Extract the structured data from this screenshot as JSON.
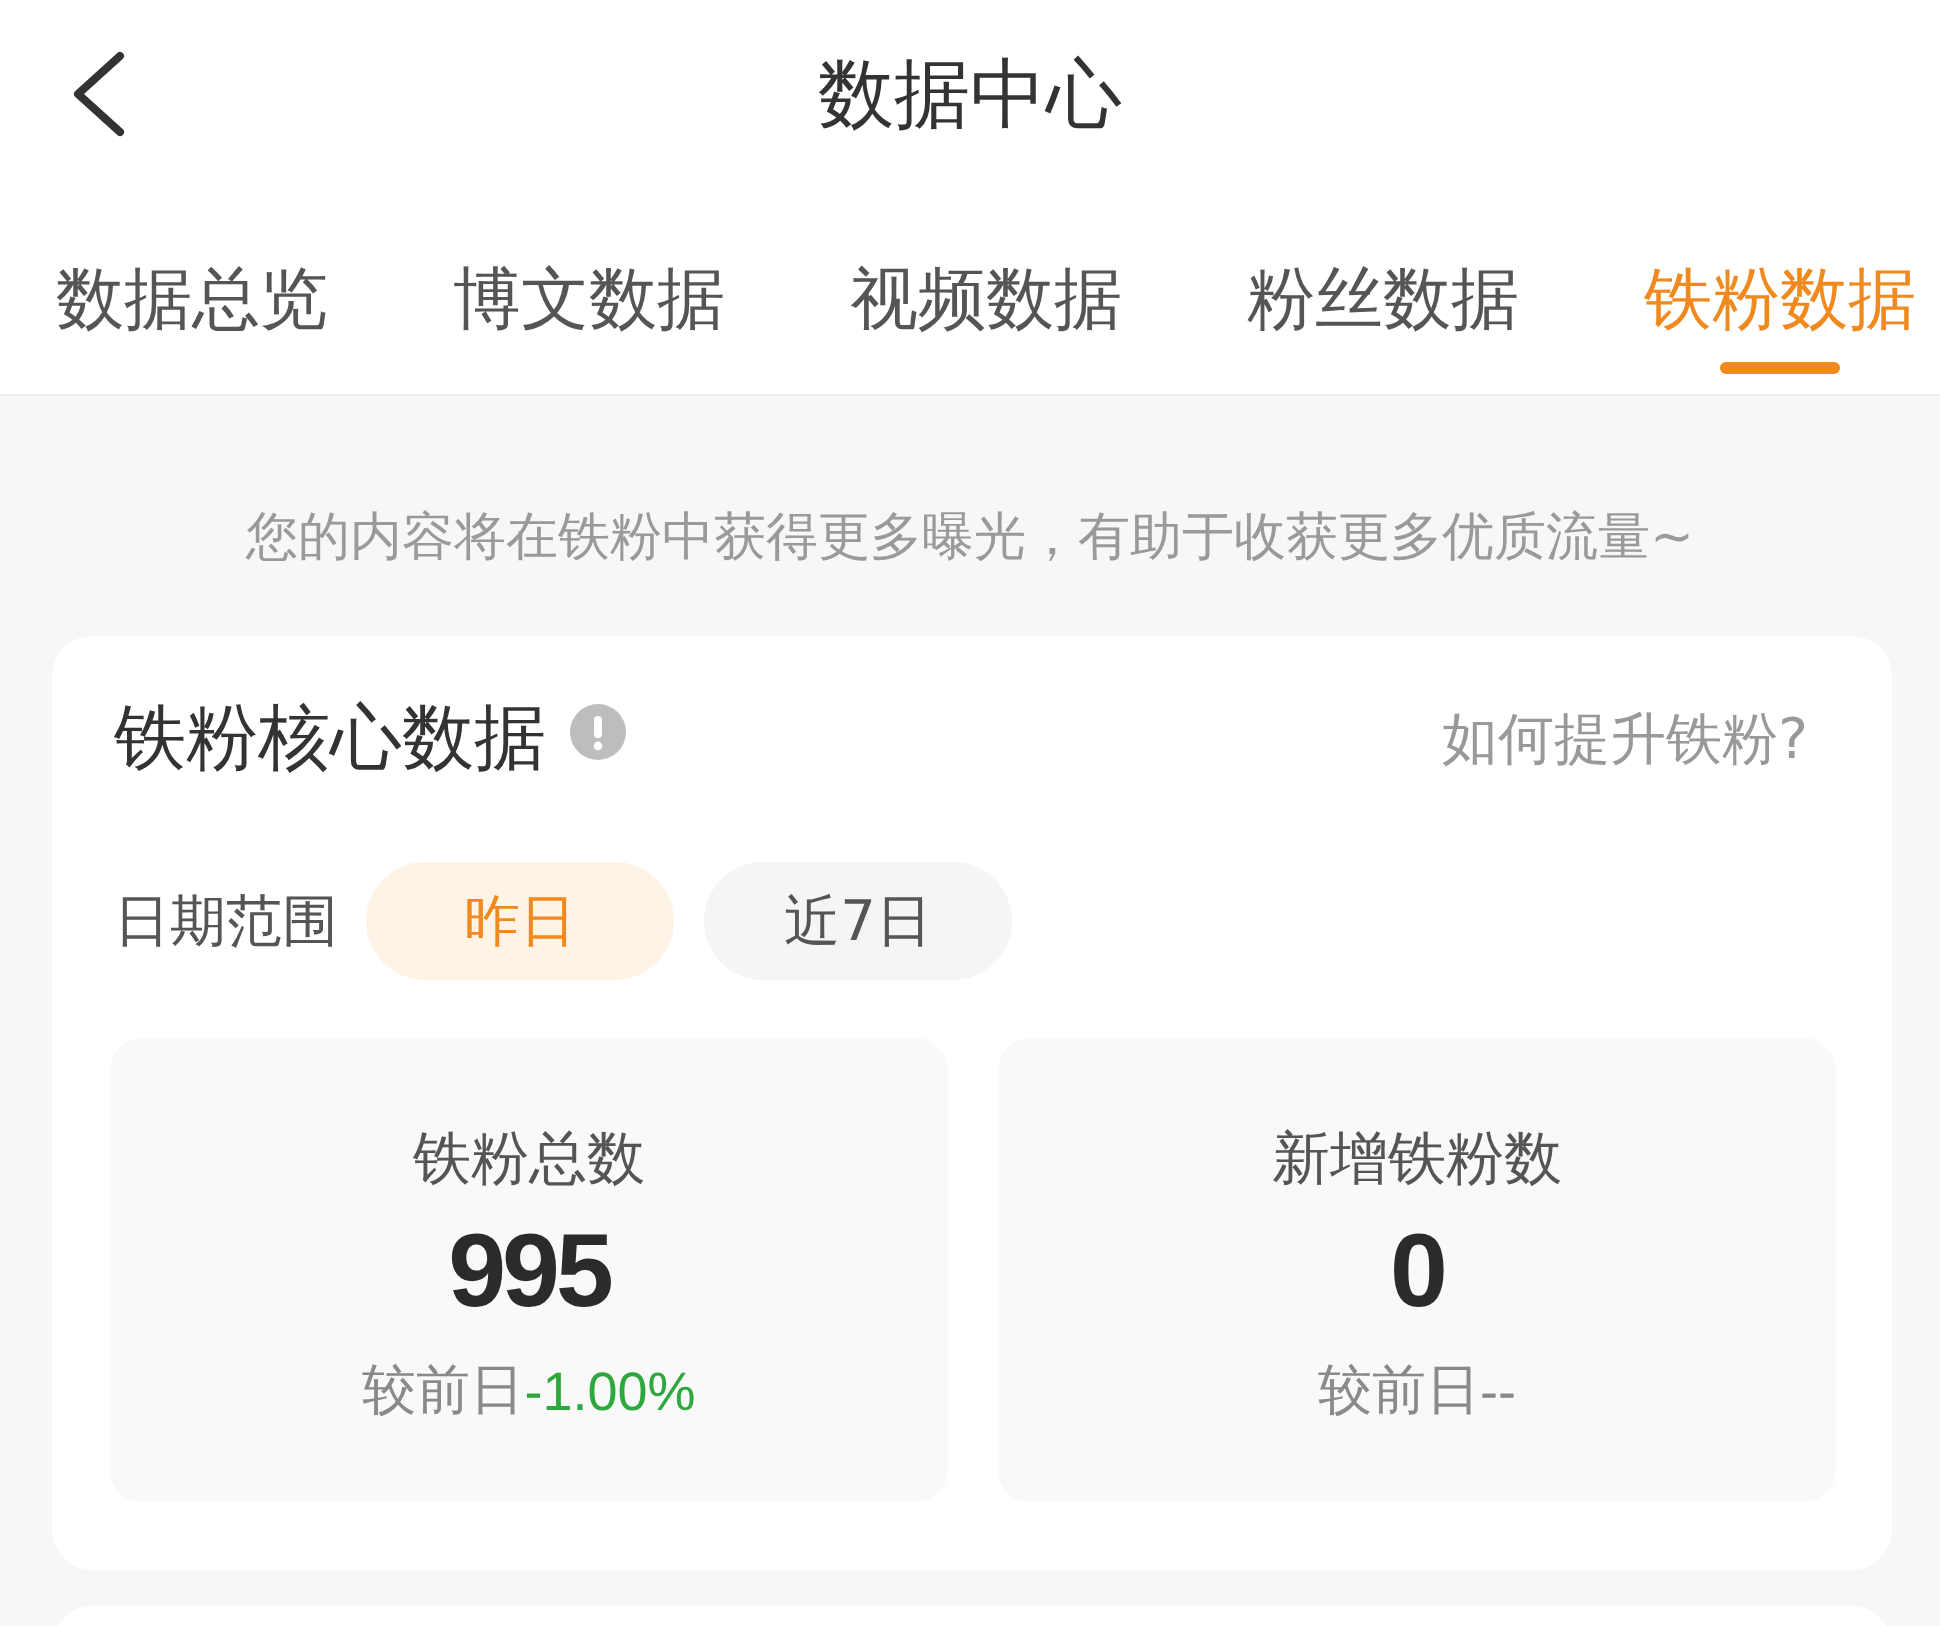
{
  "header": {
    "title": "数据中心"
  },
  "tabs": [
    {
      "label": "数据总览",
      "selected": false
    },
    {
      "label": "博文数据",
      "selected": false
    },
    {
      "label": "视频数据",
      "selected": false
    },
    {
      "label": "粉丝数据",
      "selected": false
    },
    {
      "label": "铁粉数据",
      "selected": true
    }
  ],
  "notice": "您的内容将在铁粉中获得更多曝光，有助于收获更多优质流量~",
  "core_card": {
    "title": "铁粉核心数据",
    "help_link": "如何提升铁粉?",
    "date_range": {
      "label": "日期范围",
      "options": [
        {
          "label": "昨日",
          "selected": true
        },
        {
          "label": "近7日",
          "selected": false
        }
      ]
    },
    "stats": [
      {
        "label": "铁粉总数",
        "value": "995",
        "compare_label": "较前日",
        "change": "-1.00%",
        "color": "#2ea83e"
      },
      {
        "label": "新增铁粉数",
        "value": "0",
        "compare_label": "较前日",
        "change": "--",
        "color": "#888888"
      }
    ]
  }
}
